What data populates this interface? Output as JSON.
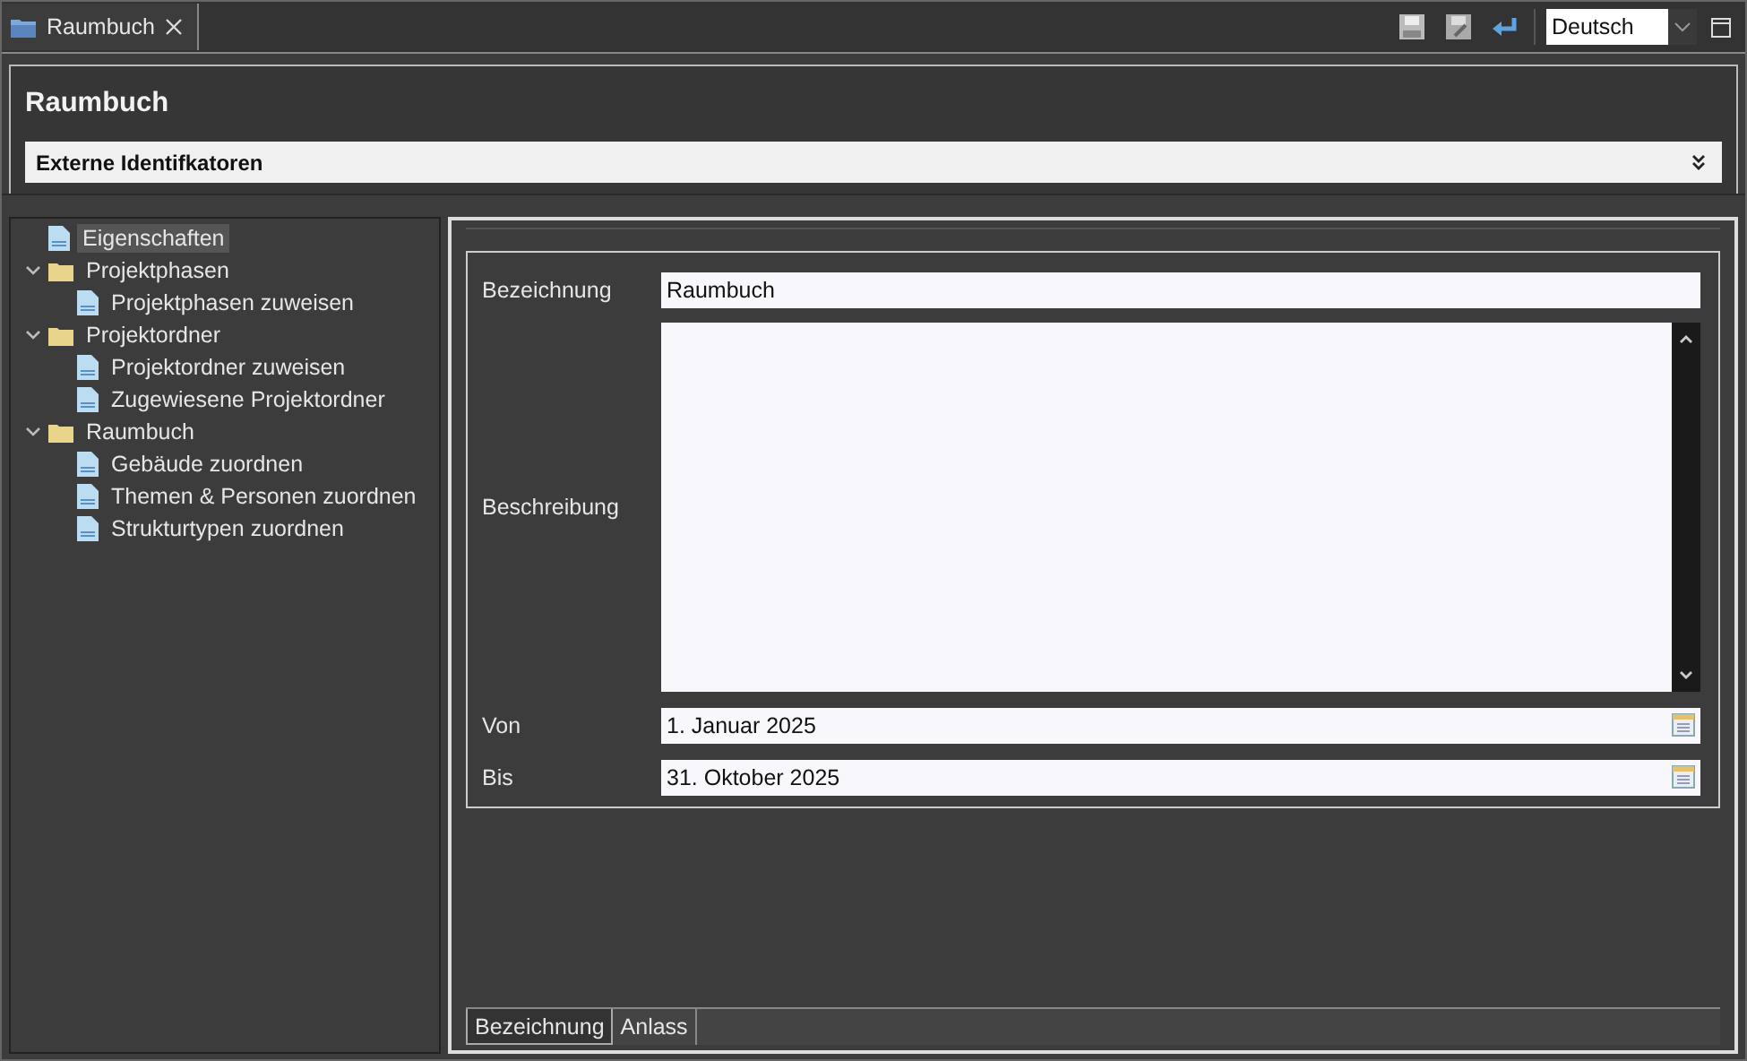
{
  "editor_tab": {
    "label": "Raumbuch"
  },
  "language": {
    "value": "Deutsch"
  },
  "header": {
    "title": "Raumbuch",
    "section": "Externe Identifkatoren"
  },
  "tree": [
    {
      "label": "Eigenschaften",
      "kind": "page",
      "selected": true
    },
    {
      "label": "Projektphasen",
      "kind": "folder",
      "selected": false,
      "expanded": true,
      "children": [
        {
          "label": "Projektphasen zuweisen",
          "kind": "page",
          "selected": false
        }
      ]
    },
    {
      "label": "Projektordner",
      "kind": "folder",
      "selected": false,
      "expanded": true,
      "children": [
        {
          "label": "Projektordner zuweisen",
          "kind": "page",
          "selected": false
        },
        {
          "label": "Zugewiesene Projektordner",
          "kind": "page",
          "selected": false
        }
      ]
    },
    {
      "label": "Raumbuch",
      "kind": "folder",
      "selected": false,
      "expanded": true,
      "children": [
        {
          "label": "Gebäude zuordnen",
          "kind": "page",
          "selected": false
        },
        {
          "label": "Themen & Personen zuordnen",
          "kind": "page",
          "selected": false
        },
        {
          "label": "Strukturtypen zuordnen",
          "kind": "page",
          "selected": false
        }
      ]
    }
  ],
  "form": {
    "bezeichnung": {
      "label": "Bezeichnung",
      "value": "Raumbuch"
    },
    "beschreibung": {
      "label": "Beschreibung"
    },
    "von": {
      "label": "Von",
      "value": "1. Januar 2025"
    },
    "bis": {
      "label": "Bis",
      "value": "31. Oktober 2025"
    }
  },
  "bottom_tabs": [
    {
      "label": "Bezeichnung",
      "selected": true
    },
    {
      "label": "Anlass",
      "selected": false
    }
  ]
}
